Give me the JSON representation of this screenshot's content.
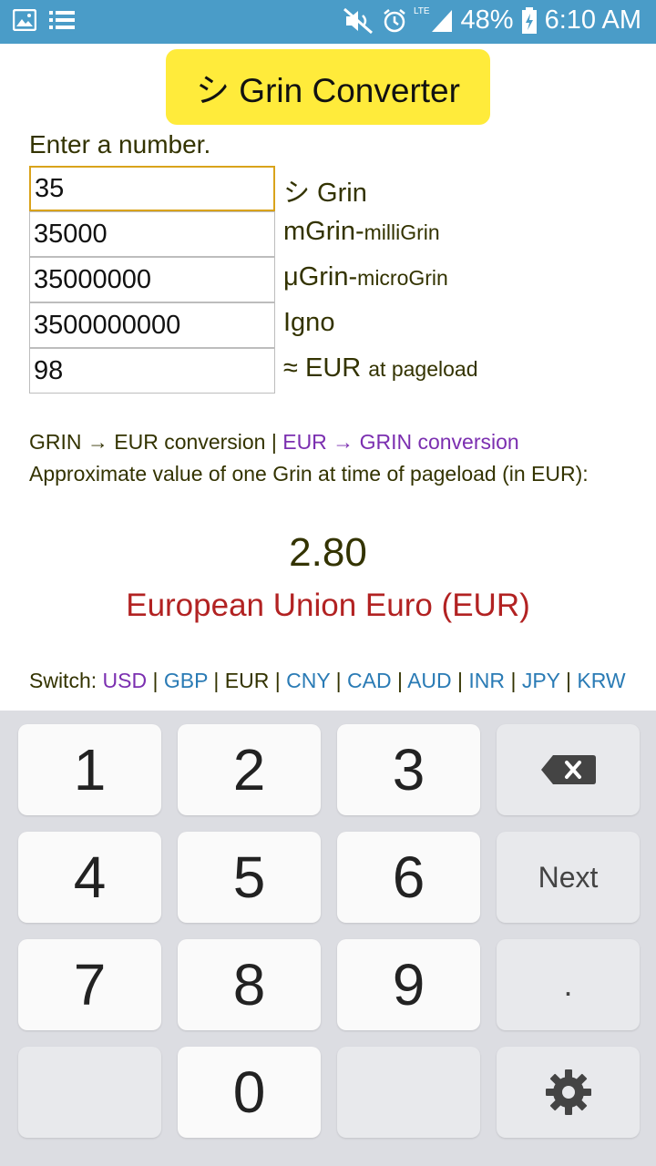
{
  "status_bar": {
    "battery": "48%",
    "time": "6:10 AM",
    "network": "LTE",
    "icons": [
      "gallery-icon",
      "list-icon",
      "mute-icon",
      "alarm-icon",
      "signal-icon",
      "battery-icon"
    ]
  },
  "app": {
    "title": "シ Grin Converter",
    "accent": "#ffeb3b"
  },
  "form": {
    "prompt": "Enter a number.",
    "rows": [
      {
        "value": "35",
        "unit": "シ Grin",
        "unit_sub": ""
      },
      {
        "value": "35000",
        "unit": "mGrin-",
        "unit_sub": "milliGrin"
      },
      {
        "value": "35000000",
        "unit": "μGrin-",
        "unit_sub": "microGrin"
      },
      {
        "value": "3500000000",
        "unit": "Igno",
        "unit_sub": ""
      },
      {
        "value": "98",
        "unit": "≈ EUR",
        "unit_sub": "at pageload"
      }
    ]
  },
  "conversion": {
    "grin_to_eur": "GRIN → EUR conversion",
    "separator": "|",
    "eur_to_grin": "EUR → GRIN conversion",
    "approx_text": "Approximate value of one Grin at time of pageload (in EUR):",
    "rate": "2.80",
    "currency_name": "European Union Euro (EUR)"
  },
  "switch": {
    "label": "Switch:",
    "currencies": [
      "USD",
      "GBP",
      "EUR",
      "CNY",
      "CAD",
      "AUD",
      "INR",
      "JPY",
      "KRW"
    ],
    "separator": "|"
  },
  "keyboard": {
    "keys": [
      "1",
      "2",
      "3",
      "4",
      "5",
      "6",
      "7",
      "8",
      "9",
      "0"
    ],
    "next": "Next",
    "dot": ".",
    "backspace_icon": "backspace-icon",
    "settings_icon": "gear-icon"
  }
}
